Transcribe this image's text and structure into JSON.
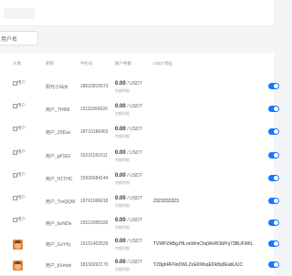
{
  "search": {
    "label": "用户名"
  },
  "table": {
    "headers": [
      "头像",
      "昵称",
      "手机号",
      "账户余额",
      "USDT地址"
    ],
    "balance_unit": "/ USDT",
    "balance_sub": "余额明细",
    "rows": [
      {
        "avatar": "broken",
        "avatar_alt": "用户",
        "nickname": "阳光小仙女",
        "phone": "18022810573",
        "balance": "0.00",
        "wallet": ""
      },
      {
        "avatar": "broken",
        "avatar_alt": "用户",
        "nickname": "用户_TH6M",
        "phone": "19111666626",
        "balance": "0.00",
        "wallet": ""
      },
      {
        "avatar": "broken",
        "avatar_alt": "用户",
        "nickname": "用户_Z9Dav",
        "phone": "18710186453",
        "balance": "0.00",
        "wallet": ""
      },
      {
        "avatar": "broken",
        "avatar_alt": "用户",
        "nickname": "用户_gFSIG",
        "phone": "15231181511",
        "balance": "0.00",
        "wallet": ""
      },
      {
        "avatar": "broken",
        "avatar_alt": "用户",
        "nickname": "用户_H1THC",
        "phone": "15920684144",
        "balance": "0.00",
        "wallet": ""
      },
      {
        "avatar": "broken",
        "avatar_alt": "用户",
        "nickname": "用户_TmQQW",
        "phone": "18761996018",
        "balance": "0.00",
        "wallet": "2323232323"
      },
      {
        "avatar": "broken",
        "avatar_alt": "用户",
        "nickname": "用户_boNDe",
        "phone": "15511085028",
        "balance": "0.00",
        "wallet": ""
      },
      {
        "avatar": "photo",
        "avatar_alt": "",
        "nickname": "用户_GvYKj",
        "phone": "15151402529",
        "balance": "0.00",
        "wallet": "TVWPZABgJHLonWmChqWsRObPnj73BUF9t6L"
      },
      {
        "avatar": "photo",
        "avatar_alt": "",
        "nickname": "用户_bXmsh",
        "phone": "18150292170",
        "balance": "0.00",
        "wallet": "TZ8ghRFNnDWLZoEKMsqEDk8q9EabUUC"
      }
    ]
  },
  "colors": {
    "accent": "#1677ff",
    "row_border": "#ebeef5"
  }
}
